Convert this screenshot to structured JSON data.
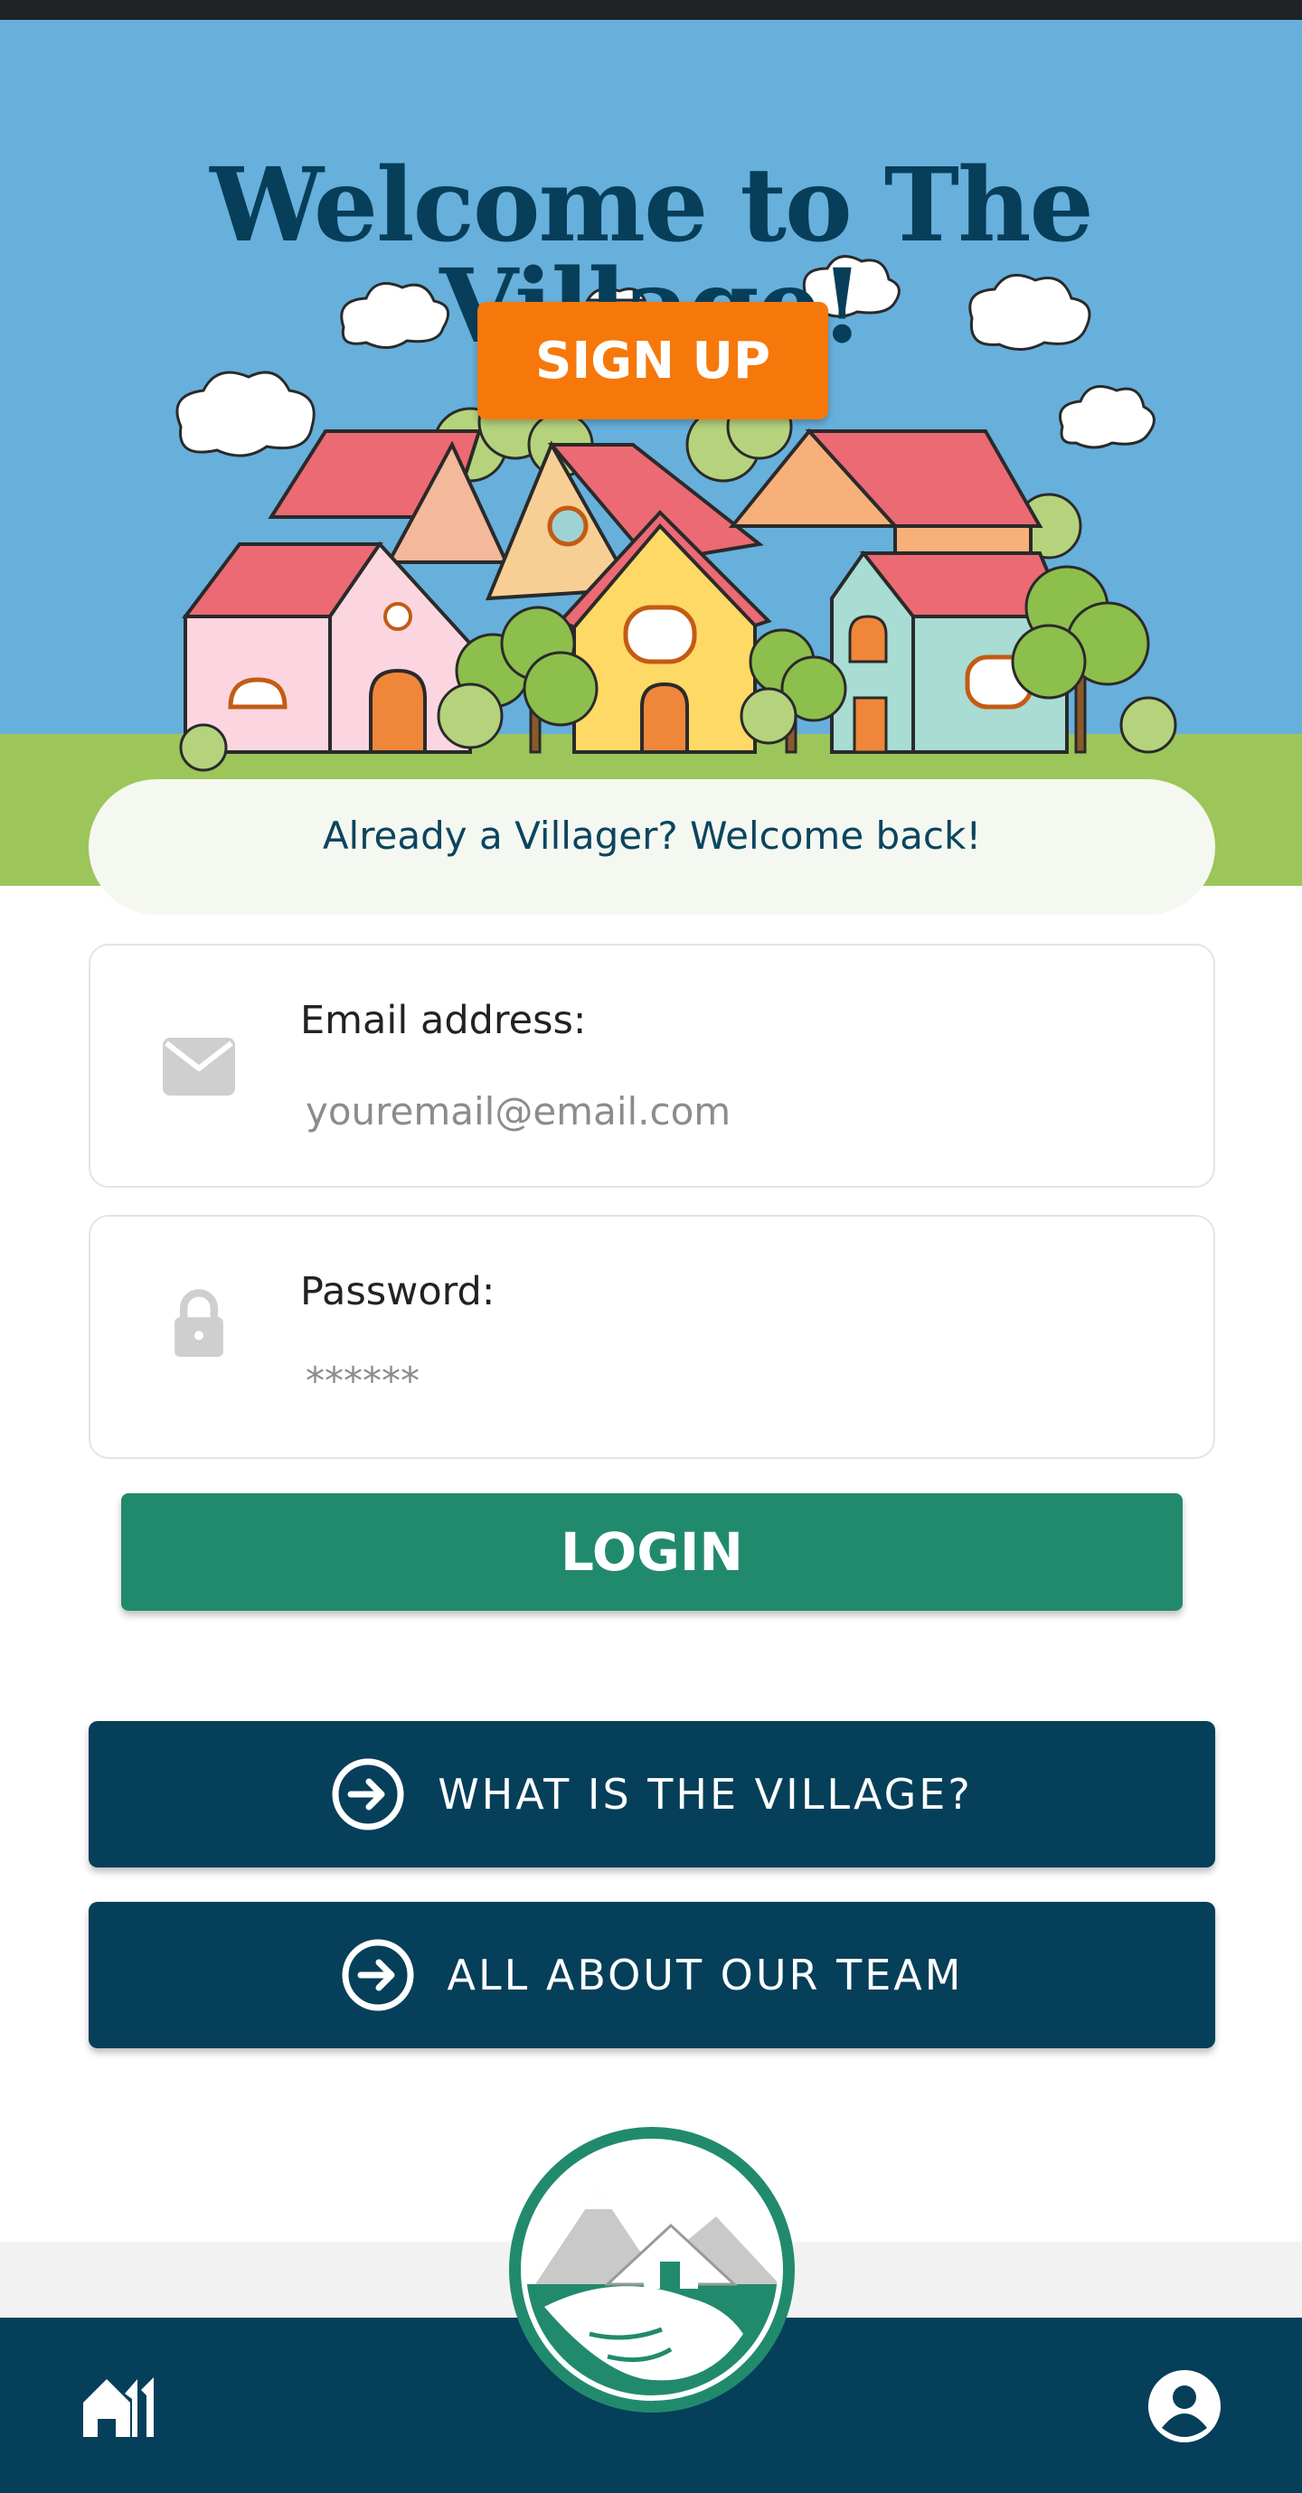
{
  "hero": {
    "title": "Welcome to The Village!",
    "signup_label": "SIGN UP",
    "returning_text": "Already a Villager? Welcome back!"
  },
  "login_form": {
    "email": {
      "label": "Email address:",
      "placeholder": "youremail@email.com",
      "value": ""
    },
    "password": {
      "label": "Password:",
      "placeholder": "******",
      "value": ""
    },
    "login_label": "LOGIN"
  },
  "links": {
    "what_is_label": "WHAT IS THE VILLAGE?",
    "team_label": "ALL ABOUT OUR TEAM"
  },
  "bottom_nav": {
    "home_icon": "home-icon",
    "logo": "village-logo",
    "profile_icon": "profile-icon"
  },
  "colors": {
    "sky": "#67b0dc",
    "title": "#073e5a",
    "signup": "#f6780b",
    "login": "#218a6d",
    "navy": "#053f5a",
    "grass": "#9cc55a"
  },
  "icons": {
    "email": "mail-icon",
    "password": "lock-icon",
    "link_arrow": "circle-arrow-right-icon"
  }
}
